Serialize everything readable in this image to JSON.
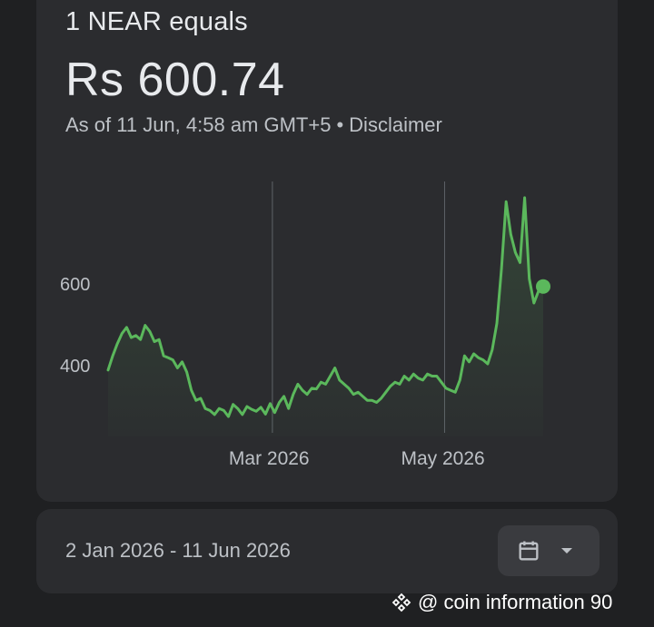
{
  "header": {
    "title": "1 NEAR equals",
    "price": "Rs 600.74",
    "as_of": "As of 11 Jun, 4:58 am GMT+5",
    "separator": "•",
    "disclaimer": "Disclaimer"
  },
  "chart_data": {
    "type": "line",
    "series": [
      {
        "values": [
          [
            0,
            395
          ],
          [
            1,
            430
          ],
          [
            2,
            460
          ],
          [
            3,
            485
          ],
          [
            4,
            500
          ],
          [
            5,
            475
          ],
          [
            6,
            480
          ],
          [
            7,
            470
          ],
          [
            8,
            505
          ],
          [
            9,
            490
          ],
          [
            10,
            465
          ],
          [
            11,
            470
          ],
          [
            12,
            430
          ],
          [
            13,
            425
          ],
          [
            14,
            420
          ],
          [
            15,
            400
          ],
          [
            16,
            415
          ],
          [
            17,
            390
          ],
          [
            18,
            345
          ],
          [
            19,
            320
          ],
          [
            20,
            325
          ],
          [
            21,
            300
          ],
          [
            22,
            295
          ],
          [
            23,
            285
          ],
          [
            24,
            300
          ],
          [
            25,
            295
          ],
          [
            26,
            280
          ],
          [
            27,
            310
          ],
          [
            28,
            300
          ],
          [
            29,
            285
          ],
          [
            30,
            305
          ],
          [
            31,
            298
          ],
          [
            32,
            293
          ],
          [
            33,
            303
          ],
          [
            34,
            286
          ],
          [
            35,
            312
          ],
          [
            36,
            290
          ],
          [
            37,
            315
          ],
          [
            38,
            330
          ],
          [
            39,
            300
          ],
          [
            40,
            335
          ],
          [
            41,
            360
          ],
          [
            42,
            345
          ],
          [
            43,
            335
          ],
          [
            44,
            350
          ],
          [
            45,
            348
          ],
          [
            46,
            365
          ],
          [
            47,
            360
          ],
          [
            48,
            380
          ],
          [
            49,
            400
          ],
          [
            50,
            370
          ],
          [
            51,
            360
          ],
          [
            52,
            350
          ],
          [
            53,
            335
          ],
          [
            54,
            340
          ],
          [
            55,
            330
          ],
          [
            56,
            320
          ],
          [
            57,
            320
          ],
          [
            58,
            315
          ],
          [
            59,
            325
          ],
          [
            60,
            340
          ],
          [
            61,
            355
          ],
          [
            62,
            365
          ],
          [
            63,
            360
          ],
          [
            64,
            380
          ],
          [
            65,
            370
          ],
          [
            66,
            385
          ],
          [
            67,
            375
          ],
          [
            68,
            370
          ],
          [
            69,
            385
          ],
          [
            70,
            380
          ],
          [
            71,
            380
          ],
          [
            72,
            365
          ],
          [
            73,
            350
          ],
          [
            74,
            345
          ],
          [
            75,
            340
          ],
          [
            76,
            370
          ],
          [
            77,
            430
          ],
          [
            78,
            415
          ],
          [
            79,
            435
          ],
          [
            80,
            425
          ],
          [
            81,
            420
          ],
          [
            82,
            410
          ],
          [
            83,
            445
          ],
          [
            84,
            510
          ],
          [
            85,
            645
          ],
          [
            86,
            810
          ],
          [
            87,
            730
          ],
          [
            88,
            685
          ],
          [
            89,
            660
          ],
          [
            90,
            820
          ],
          [
            91,
            620
          ],
          [
            92,
            560
          ],
          [
            93,
            590
          ],
          [
            94,
            601
          ]
        ]
      }
    ],
    "x_tick_labels": [
      "Mar 2026",
      "May 2026"
    ],
    "x_tick_positions": [
      35.5,
      72.7
    ],
    "y_ticks": [
      400,
      600
    ],
    "ylim": [
      240,
      860
    ],
    "xlim": [
      0,
      94
    ],
    "line_color": "#5bb85c",
    "grid": false
  },
  "range": {
    "label": "2 Jan 2026 - 11 Jun 2026"
  },
  "calendar_button": {
    "icon": "calendar-icon",
    "dropdown_icon": "chevron-down-icon"
  },
  "watermark": {
    "text": "@ coin information 90",
    "icon": "binance-logo"
  }
}
